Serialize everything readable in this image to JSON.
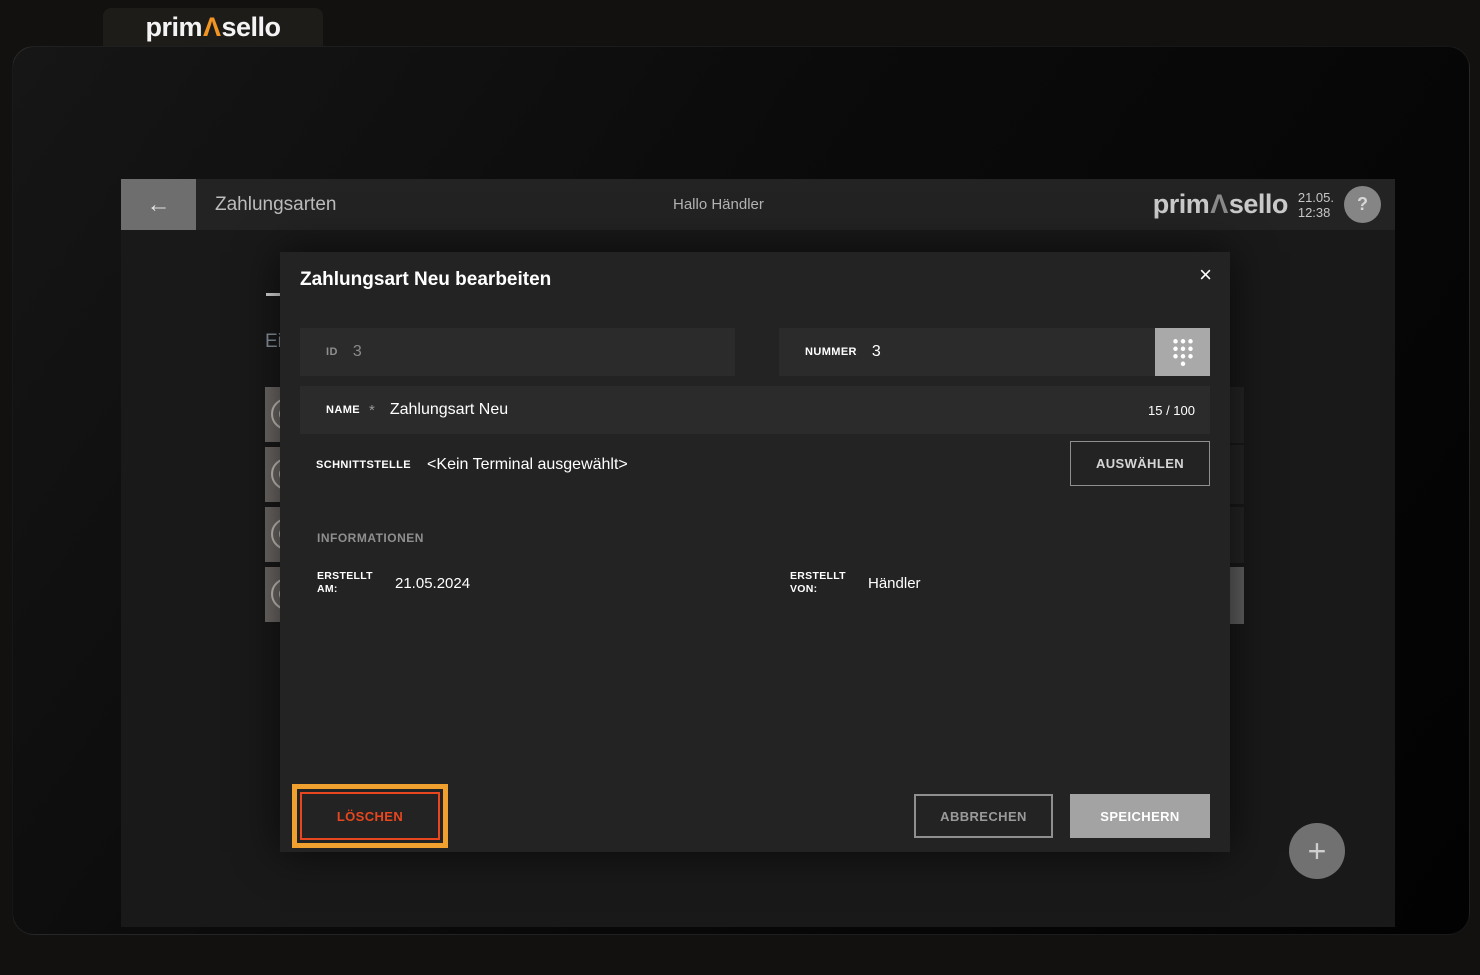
{
  "brand": {
    "logo_prefix": "prim",
    "logo_mark": "Λ",
    "logo_suffix": "sello",
    "accent_color": "#F29422"
  },
  "header": {
    "back_icon": "←",
    "title": "Zahlungsarten",
    "greeting": "Hallo Händler",
    "date": "21.05.",
    "time": "12:38",
    "help_icon": "?"
  },
  "background_page": {
    "heading_fragment": "Ei",
    "visible_list_rows": 4,
    "selected_row_index": 4
  },
  "modal": {
    "title": "Zahlungsart Neu bearbeiten",
    "close_icon": "×",
    "fields": {
      "id": {
        "label": "ID",
        "value": "3"
      },
      "nummer": {
        "label": "NUMMER",
        "value": "3",
        "keypad_icon": "dialpad"
      },
      "name": {
        "label": "NAME",
        "required_marker": "*",
        "value": "Zahlungsart Neu",
        "counter": "15 / 100"
      },
      "schnittstelle": {
        "label": "SCHNITTSTELLE",
        "value": "<Kein Terminal ausgewählt>",
        "button": "AUSWÄHLEN"
      }
    },
    "info": {
      "section_title": "INFORMATIONEN",
      "created_at": {
        "label": "ERSTELLT AM:",
        "value": "21.05.2024"
      },
      "created_by": {
        "label": "ERSTELLT VON:",
        "value": "Händler"
      }
    },
    "footer": {
      "delete": "LÖSCHEN",
      "cancel": "ABBRECHEN",
      "save": "SPEICHERN"
    }
  },
  "fab": {
    "icon": "+"
  },
  "colors": {
    "accent_orange": "#F29422",
    "delete_red": "#E8461E",
    "annotation_highlight": "#F0A02F"
  }
}
